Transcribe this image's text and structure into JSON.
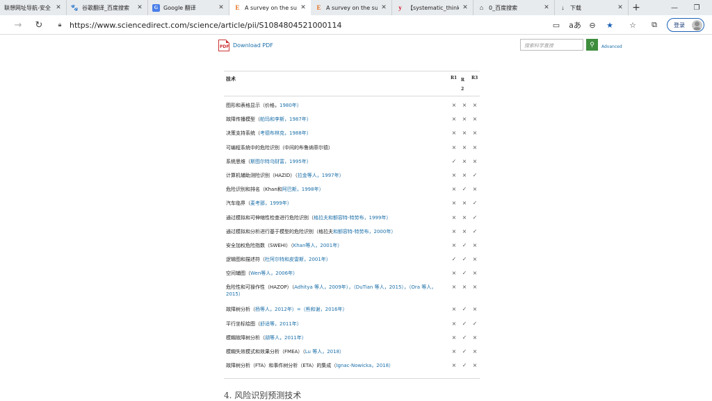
{
  "tabs": [
    {
      "label": "联想网址导航-安全",
      "icon": "",
      "icon_name": "none",
      "active": false
    },
    {
      "label": "谷歌翻译_百度搜索",
      "icon": "🐾",
      "icon_name": "baidu-paw-icon",
      "active": false
    },
    {
      "label": "Google 翻译",
      "icon": "G",
      "icon_name": "google-translate-icon",
      "active": false
    },
    {
      "label": "A survey on the su",
      "icon": "E",
      "icon_name": "elsevier-icon",
      "active": true
    },
    {
      "label": "A survey on the su",
      "icon": "E",
      "icon_name": "elsevier-icon",
      "active": false
    },
    {
      "label": "【systematic_think",
      "icon": "y",
      "icon_name": "youdao-icon",
      "active": false
    },
    {
      "label": "0_百度搜索",
      "icon": "⌂",
      "icon_name": "search-page-icon",
      "active": false
    },
    {
      "label": "下载",
      "icon": "↓",
      "icon_name": "download-icon",
      "active": false
    }
  ],
  "window": {
    "new_tab": "+",
    "minimize": "—",
    "restore": "❐"
  },
  "address": {
    "url": "https://www.sciencedirect.com/science/article/pii/S1084804521000114",
    "login_label": "登录"
  },
  "page": {
    "download_pdf": "Download PDF",
    "pdf_badge": "PDF",
    "search_placeholder": "搜索科学直接",
    "advanced": "Advanced",
    "table_header": {
      "technique": "技术",
      "r1": "R1",
      "r2": "R 2",
      "r3": "R3"
    },
    "rows": [
      {
        "text": "图形和表格显示（价格，",
        "ref": "1980年）",
        "r1": "×",
        "r2": "×",
        "r3": "×"
      },
      {
        "text": "故障传播模型（",
        "ref": "帕玛和李斯，1987年）",
        "r1": "×",
        "r2": "×",
        "r3": "×"
      },
      {
        "text": "决策支持系统（",
        "ref": "考德布林克，1988年）",
        "r1": "×",
        "r2": "×",
        "r3": "×"
      },
      {
        "text": "可编程系统中的危险识别（中间的布鲁纳菲尔德）",
        "ref": "",
        "r1": "×",
        "r2": "×",
        "r3": "×"
      },
      {
        "text": "系统思维（",
        "ref": "斯图尔特乌财富，1995年）",
        "r1": "✓",
        "r2": "×",
        "r3": "×"
      },
      {
        "text": "计算机辅助测险识别（HAZID）（",
        "ref": "拉金等人，1997年）",
        "r1": "×",
        "r2": "×",
        "r3": "✓"
      },
      {
        "text": "危险识别和排名（Khan和",
        "ref": "阿巴斯，1998年）",
        "r1": "×",
        "r2": "✓",
        "r3": "×"
      },
      {
        "text": "汽车临界（",
        "ref": "麦考那，1999年）",
        "r1": "×",
        "r2": "×",
        "r3": "✓"
      },
      {
        "text": "通过模拟和可伸缩性检查进行危险识别（",
        "ref": "格拉夫和额容特-特劳布，1999年）",
        "r1": "×",
        "r2": "×",
        "r3": "✓"
      },
      {
        "text": "通过模拟和分析进行基于模型的危险识别（格拉夫",
        "ref": "和额容特-特劳布，2000年）",
        "r1": "×",
        "r2": "×",
        "r3": "✓"
      },
      {
        "text": "安全加权危险指数（SWEHI）（",
        "ref": "Khan等人，2001年）",
        "r1": "×",
        "r2": "✓",
        "r3": "×"
      },
      {
        "text": "逻辑图和描述符（",
        "ref": "杜阿尔特和皮雷斯，2001年）",
        "r1": "✓",
        "r2": "✓",
        "r3": "×"
      },
      {
        "text": "空间辅图（",
        "ref": "Wen等人，2006年）",
        "r1": "×",
        "r2": "✓",
        "r3": "×"
      },
      {
        "text": "危险性和可操作性（HAZOP）（",
        "ref": "Adhitya 等人，2009年），（DuTian 等人，2015），（Ora 等人，2015）",
        "r1": "×",
        "r2": "×",
        "r3": "×",
        "tall": true
      },
      {
        "text": "故障树分析（",
        "ref": "杨等人，2012年）=（熊和谢，2016年）",
        "r1": "×",
        "r2": "✓",
        "r3": "×"
      },
      {
        "text": "平行坐标绘图（",
        "ref": "舒适等，2011年）",
        "r1": "×",
        "r2": "✓",
        "r3": "✓"
      },
      {
        "text": "模糊故障树分析（",
        "ref": "胡等人，2011年）",
        "r1": "×",
        "r2": "✓",
        "r3": "×"
      },
      {
        "text": "模糊失效模式和效果分析（FMEA）（",
        "ref": "Lu 等人，2018）",
        "r1": "×",
        "r2": "✓",
        "r3": "×"
      },
      {
        "text": "故障树分析（FTA）和事件树分析（ETA）的集成（",
        "ref": "Ignac-Nowicka，2018）",
        "r1": "×",
        "r2": "✓",
        "r3": "×"
      }
    ],
    "section_heading": "4. 风险识别预测技术"
  }
}
